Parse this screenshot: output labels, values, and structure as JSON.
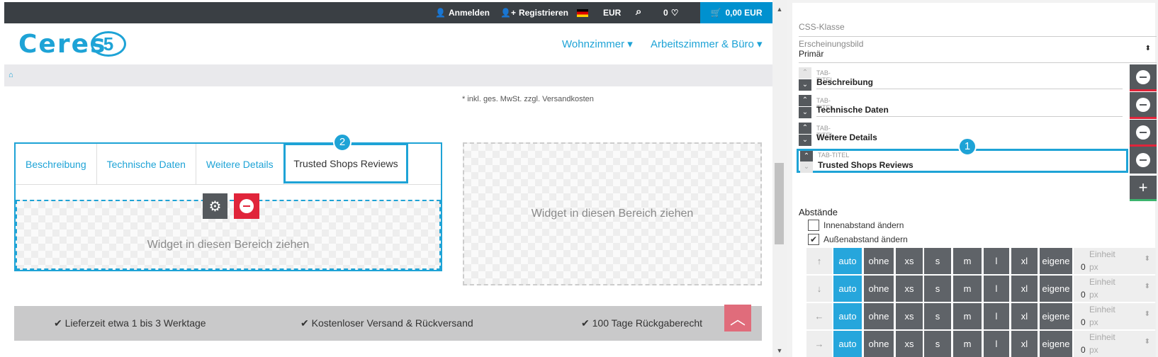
{
  "topbar": {
    "login": "Anmelden",
    "register": "Registrieren",
    "currency": "EUR",
    "wish_count": "0",
    "cart_total": "0,00 EUR"
  },
  "logo": {
    "text": "Ceres",
    "badge": "5"
  },
  "nav": {
    "items": [
      "Wohnzimmer",
      "Arbeitszimmer & Büro"
    ]
  },
  "vat_note": "* inkl. ges. MwSt. zzgl. Versandkosten",
  "tabs": [
    "Beschreibung",
    "Technische Daten",
    "Weitere Details",
    "Trusted Shops Reviews"
  ],
  "dropzone_text": "Widget in diesen Bereich ziehen",
  "badges": {
    "one": "1",
    "two": "2"
  },
  "features": [
    "Lieferzeit etwa 1 bis 3 Werktage",
    "Kostenloser Versand & Rückversand",
    "100 Tage Rückgaberecht"
  ],
  "panel": {
    "css_class_placeholder": "CSS-Klasse",
    "appearance_label": "Erscheinungsbild",
    "appearance_value": "Primär",
    "tab_title_label": "TAB-TITEL",
    "tab_titles": [
      "Beschreibung",
      "Technische Daten",
      "Weitere Details",
      "Trusted Shops Reviews"
    ],
    "spacing_label": "Abstände",
    "inner_label": "Innenabstand ändern",
    "outer_label": "Außenabstand ändern",
    "margin_options": [
      "auto",
      "ohne",
      "xs",
      "s",
      "m",
      "l",
      "xl",
      "eigene"
    ],
    "unit_label": "Einheit",
    "unit_value": "0",
    "unit_suffix": "px",
    "row_icons": [
      "↑",
      "↓",
      "←",
      "→"
    ]
  },
  "colors": {
    "accent": "#1ea3d6",
    "danger": "#e0243a",
    "dark": "#55595d"
  }
}
